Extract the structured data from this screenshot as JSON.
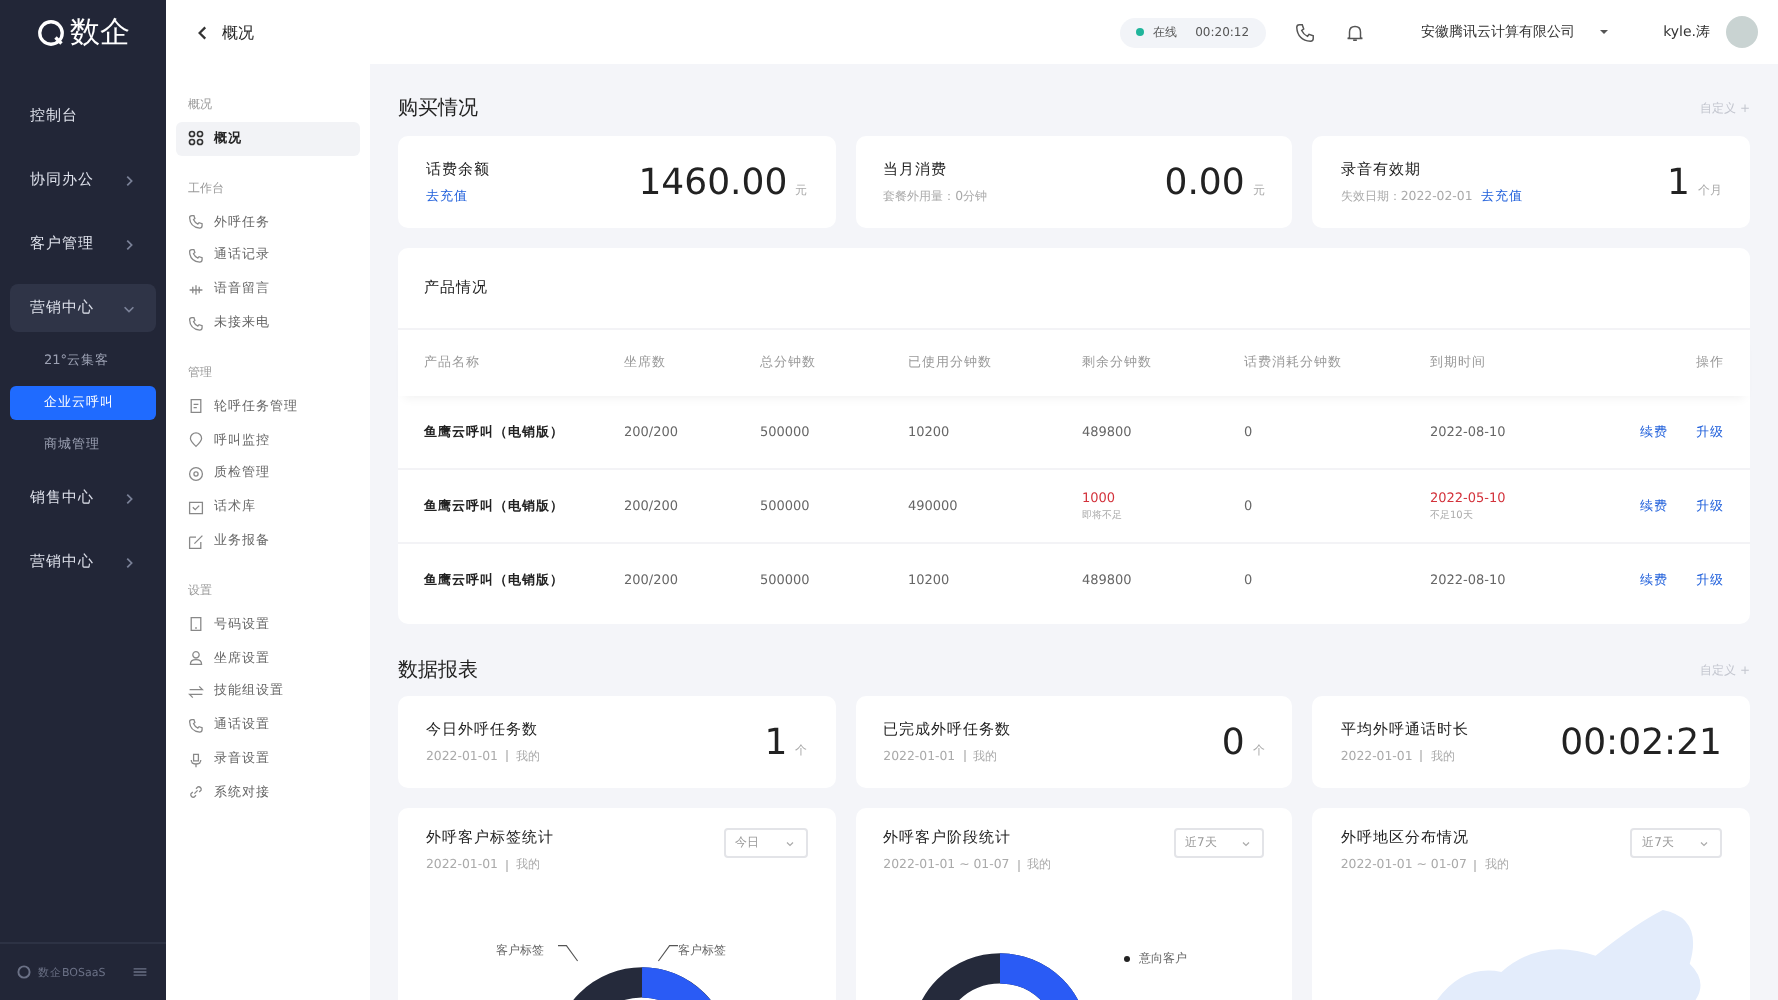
{
  "brand": {
    "name": "数企"
  },
  "nav": [
    {
      "label": "控制台",
      "expanded": false,
      "has_arrow": false
    },
    {
      "label": "协同办公",
      "expanded": false,
      "has_arrow": true
    },
    {
      "label": "客户管理",
      "expanded": false,
      "has_arrow": true
    },
    {
      "label": "营销中心",
      "expanded": true,
      "has_arrow": true,
      "children": [
        {
          "label": "21°云集客",
          "selected": false
        },
        {
          "label": "企业云呼叫",
          "selected": true
        },
        {
          "label": "商城管理",
          "selected": false
        }
      ]
    },
    {
      "label": "销售中心",
      "expanded": false,
      "has_arrow": true
    },
    {
      "label": "营销中心",
      "expanded": false,
      "has_arrow": true
    }
  ],
  "footer": {
    "label": "数企BOSaaS"
  },
  "topbar": {
    "back_label": "概况",
    "status": "在线",
    "timer": "00:20:12",
    "company": "安徽腾讯云计算有限公司",
    "user": "kyle.涛"
  },
  "submenu": [
    {
      "heading": "概况",
      "items": [
        {
          "label": "概况",
          "selected": true
        }
      ]
    },
    {
      "heading": "工作台",
      "items": [
        {
          "label": "外呼任务",
          "selected": false
        },
        {
          "label": "通话记录",
          "selected": false
        },
        {
          "label": "语音留言",
          "selected": false
        },
        {
          "label": "未接来电",
          "selected": false
        }
      ]
    },
    {
      "heading": "管理",
      "items": [
        {
          "label": "轮呼任务管理",
          "selected": false
        },
        {
          "label": "呼叫监控",
          "selected": false
        },
        {
          "label": "质检管理",
          "selected": false
        },
        {
          "label": "话术库",
          "selected": false
        },
        {
          "label": "业务报备",
          "selected": false
        }
      ]
    },
    {
      "heading": "设置",
      "items": [
        {
          "label": "号码设置",
          "selected": false
        },
        {
          "label": "坐席设置",
          "selected": false
        },
        {
          "label": "技能组设置",
          "selected": false
        },
        {
          "label": "通话设置",
          "selected": false
        },
        {
          "label": "录音设置",
          "selected": false
        },
        {
          "label": "系统对接",
          "selected": false
        }
      ]
    }
  ],
  "purchase": {
    "title": "购买情况",
    "custom": "自定义 +",
    "cards": [
      {
        "title": "话费余额",
        "link": "去充值",
        "value": "1460.00",
        "unit": "元"
      },
      {
        "title": "当月消费",
        "sub": "套餐外用量：0分钟",
        "value": "0.00",
        "unit": "元"
      },
      {
        "title": "录音有效期",
        "sub": "失效日期：2022-02-01",
        "link": "去充值",
        "value": "1",
        "unit": "个月"
      }
    ]
  },
  "products": {
    "title": "产品情况",
    "columns": [
      "产品名称",
      "坐席数",
      "总分钟数",
      "已使用分钟数",
      "剩余分钟数",
      "话费消耗分钟数",
      "到期时间",
      "操作"
    ],
    "rows": [
      {
        "name": "鱼鹰云呼叫（电销版）",
        "seats": "200/200",
        "total": "500000",
        "used": "10200",
        "remaining": "489800",
        "remaining_warn": false,
        "fee": "0",
        "expiry": "2022-08-10",
        "expiry_warn": false,
        "actions": [
          "续费",
          "升级"
        ]
      },
      {
        "name": "鱼鹰云呼叫（电销版）",
        "seats": "200/200",
        "total": "500000",
        "used": "490000",
        "remaining": "1000",
        "remaining_warn": true,
        "remaining_note": "即将不足",
        "fee": "0",
        "expiry": "2022-05-10",
        "expiry_warn": true,
        "expiry_note": "不足10天",
        "actions": [
          "续费",
          "升级"
        ]
      },
      {
        "name": "鱼鹰云呼叫（电销版）",
        "seats": "200/200",
        "total": "500000",
        "used": "10200",
        "remaining": "489800",
        "remaining_warn": false,
        "fee": "0",
        "expiry": "2022-08-10",
        "expiry_warn": false,
        "actions": [
          "续费",
          "升级"
        ]
      }
    ]
  },
  "report": {
    "title": "数据报表",
    "custom": "自定义 +",
    "stats": [
      {
        "title": "今日外呼任务数",
        "date": "2022-01-01",
        "owner": "我的",
        "value": "1",
        "unit": "个"
      },
      {
        "title": "已完成外呼任务数",
        "date": "2022-01-01",
        "owner": "我的",
        "value": "0",
        "unit": "个"
      },
      {
        "title": "平均外呼通话时长",
        "date": "2022-01-01",
        "owner": "我的",
        "value": "00:02:21"
      }
    ],
    "charts": [
      {
        "kind": "donut-tags",
        "title": "外呼客户标签统计",
        "date": "2022-01-01",
        "owner": "我的",
        "range": "今日",
        "labels": [
          "客户标签",
          "客户标签"
        ]
      },
      {
        "kind": "donut-legend",
        "title": "外呼客户阶段统计",
        "date": "2022-01-01 ~ 01-07",
        "owner": "我的",
        "range": "近7天",
        "labels": [
          "意向客户"
        ]
      },
      {
        "kind": "map",
        "title": "外呼地区分布情况",
        "date": "2022-01-01 ~ 01-07",
        "owner": "我的",
        "range": "近7天"
      }
    ]
  }
}
